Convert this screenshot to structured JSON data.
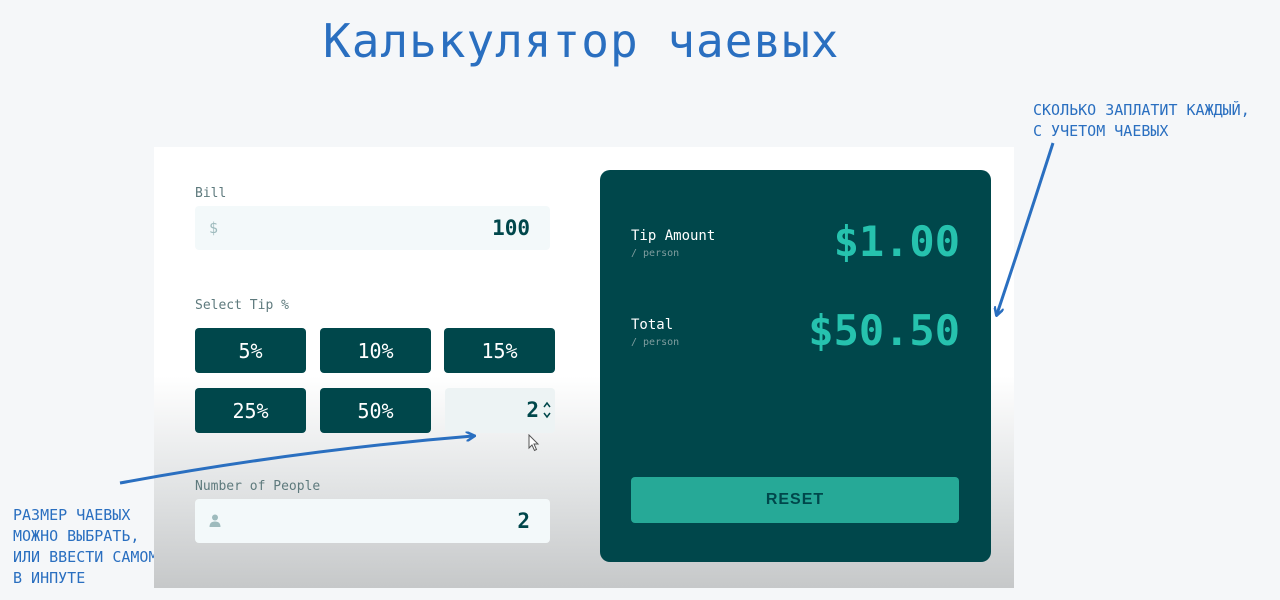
{
  "slide": {
    "title": "Калькулятор чаевых",
    "note_result": "СКОЛЬКО ЗАПЛАТИТ КАЖДЫЙ,\nС УЧЕТОМ ЧАЕВЫХ",
    "note_tip": "РАЗМЕР ЧАЕВЫХ\nМОЖНО ВЫБРАТЬ,\nИЛИ ВВЕСТИ САМОМУ\nВ ИНПУТЕ"
  },
  "colors": {
    "annotation": "#2a6fc0",
    "dark_cyan": "#00474b",
    "strong_cyan": "#26c2ae",
    "reset_bg": "#26a997"
  },
  "bill": {
    "label": "Bill",
    "prefix": "$",
    "value": "100"
  },
  "tip": {
    "label": "Select Tip %",
    "options": [
      "5%",
      "10%",
      "15%",
      "25%",
      "50%"
    ],
    "custom_value": "2",
    "spinner_icon": "spinner-arrows-icon"
  },
  "people": {
    "label": "Number of People",
    "icon": "person-icon",
    "value": "2"
  },
  "result": {
    "tip_label": "Tip Amount",
    "tip_sub": "/ person",
    "tip_value": "$1.00",
    "total_label": "Total",
    "total_sub": "/ person",
    "total_value": "$50.50",
    "reset_label": "RESET"
  }
}
